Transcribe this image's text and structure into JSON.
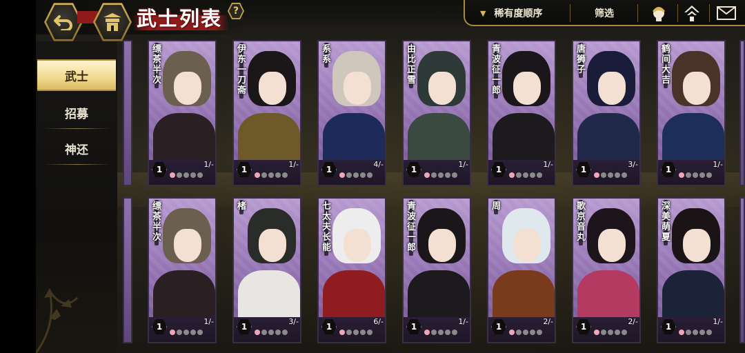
{
  "header": {
    "title": "武士列表",
    "back_icon": "back-arrow-icon",
    "home_icon": "castle-icon",
    "help_label": "?",
    "sort_label": "稀有度顺序",
    "filter_label": "筛选"
  },
  "top_icons": [
    "character-icon",
    "home-up-icon",
    "mail-icon"
  ],
  "sidebar": {
    "items": [
      {
        "label": "武士",
        "active": true
      },
      {
        "label": "招募",
        "active": false
      },
      {
        "label": "神还",
        "active": false
      }
    ]
  },
  "colors": {
    "accent_gold": "#d6b35c",
    "card_bg": "#b79ad0",
    "petal_on": "#f0a6b6",
    "title_red": "#8e1a1a"
  },
  "cards": [
    {
      "name": "缥茶半次",
      "level": "1",
      "count": "1/-",
      "hair": "#6b6050",
      "body": "#2a1f22",
      "petals_on": 1
    },
    {
      "name": "伊东一刀斋",
      "level": "1",
      "count": "1/-",
      "hair": "#1b1718",
      "body": "#6e5a28",
      "petals_on": 1
    },
    {
      "name": "系系",
      "level": "1",
      "count": "4/-",
      "hair": "#cfc7bc",
      "body": "#1e2a5a",
      "petals_on": 1
    },
    {
      "name": "由比正雪",
      "level": "1",
      "count": "1/-",
      "hair": "#2d3a38",
      "body": "#3a4a40",
      "petals_on": 1
    },
    {
      "name": "青波征一郎",
      "level": "1",
      "count": "1/-",
      "hair": "#1a1619",
      "body": "#1c1a1c",
      "petals_on": 1
    },
    {
      "name": "唐狮子",
      "level": "1",
      "count": "3/-",
      "hair": "#1a1d3a",
      "body": "#20294a",
      "petals_on": 1
    },
    {
      "name": "鹤间大吉",
      "level": "1",
      "count": "1/-",
      "hair": "#4a3328",
      "body": "#1d2f58",
      "petals_on": 1
    },
    {
      "name": "缥茶半次",
      "level": "1",
      "count": "1/-",
      "hair": "#6b6050",
      "body": "#2a1f22",
      "petals_on": 1
    },
    {
      "name": "楮",
      "level": "1",
      "count": "3/-",
      "hair": "#2a2c2a",
      "body": "#e8e6e2",
      "petals_on": 1
    },
    {
      "name": "七太夫长能",
      "level": "1",
      "count": "6/-",
      "hair": "#ededed",
      "body": "#8e1c20",
      "petals_on": 1
    },
    {
      "name": "青波征一郎",
      "level": "1",
      "count": "1/-",
      "hair": "#1a1619",
      "body": "#1c1a1c",
      "petals_on": 1
    },
    {
      "name": "周",
      "level": "1",
      "count": "2/-",
      "hair": "#dfe8ec",
      "body": "#7a3b1c",
      "petals_on": 1
    },
    {
      "name": "歌京音丸",
      "level": "1",
      "count": "2/-",
      "hair": "#1e141c",
      "body": "#b43a62",
      "petals_on": 1
    },
    {
      "name": "深美萌夏",
      "level": "1",
      "count": "1/-",
      "hair": "#1a1416",
      "body": "#1c2238",
      "petals_on": 1
    }
  ]
}
